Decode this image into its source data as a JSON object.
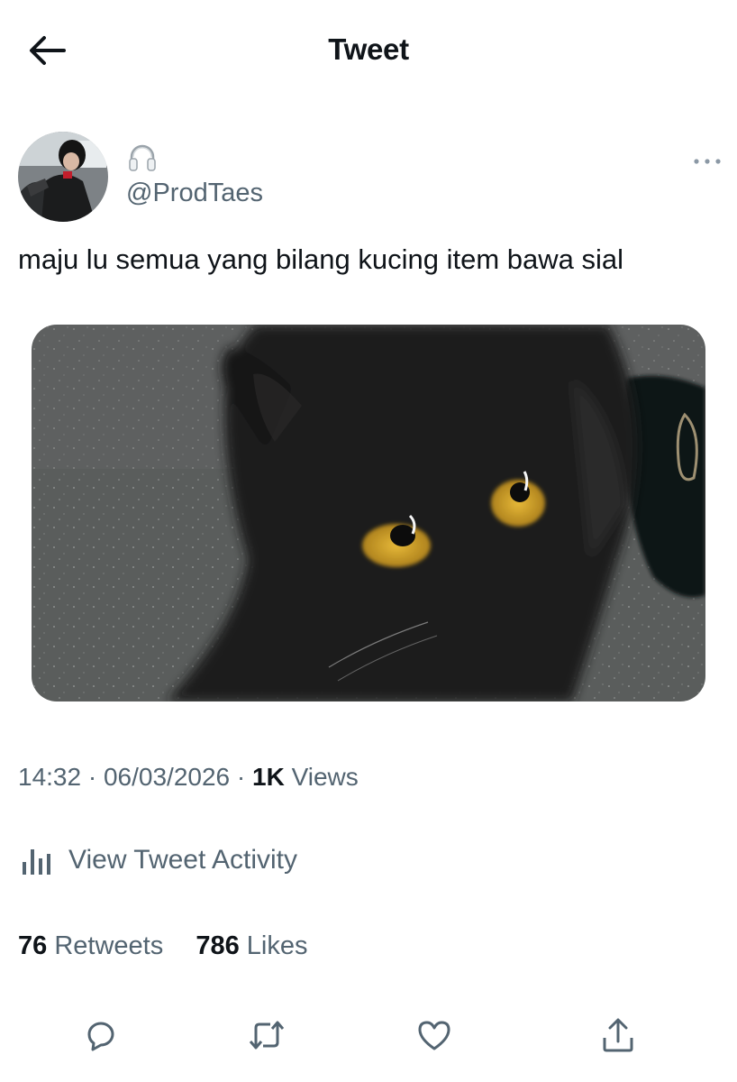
{
  "header": {
    "title": "Tweet",
    "back_icon": "arrow-left-icon"
  },
  "author": {
    "handle": "@ProdTaes",
    "name_emoji_icon": "headphones-icon"
  },
  "tweet": {
    "text": "maju lu semua yang bilang kucing item bawa sial"
  },
  "meta": {
    "time": "14:32",
    "separator": " · ",
    "date": "06/03/2026",
    "views_count": "1K",
    "views_label": " Views"
  },
  "activity": {
    "label": "View Tweet Activity",
    "icon": "bar-chart-icon"
  },
  "stats": {
    "retweets_count": "76",
    "retweets_label": " Retweets",
    "likes_count": "786",
    "likes_label": " Likes"
  },
  "actions": [
    "reply-icon",
    "retweet-icon",
    "like-icon",
    "share-icon"
  ],
  "colors": {
    "text": "#0f1419",
    "secondary": "#536471",
    "background": "#ffffff"
  }
}
